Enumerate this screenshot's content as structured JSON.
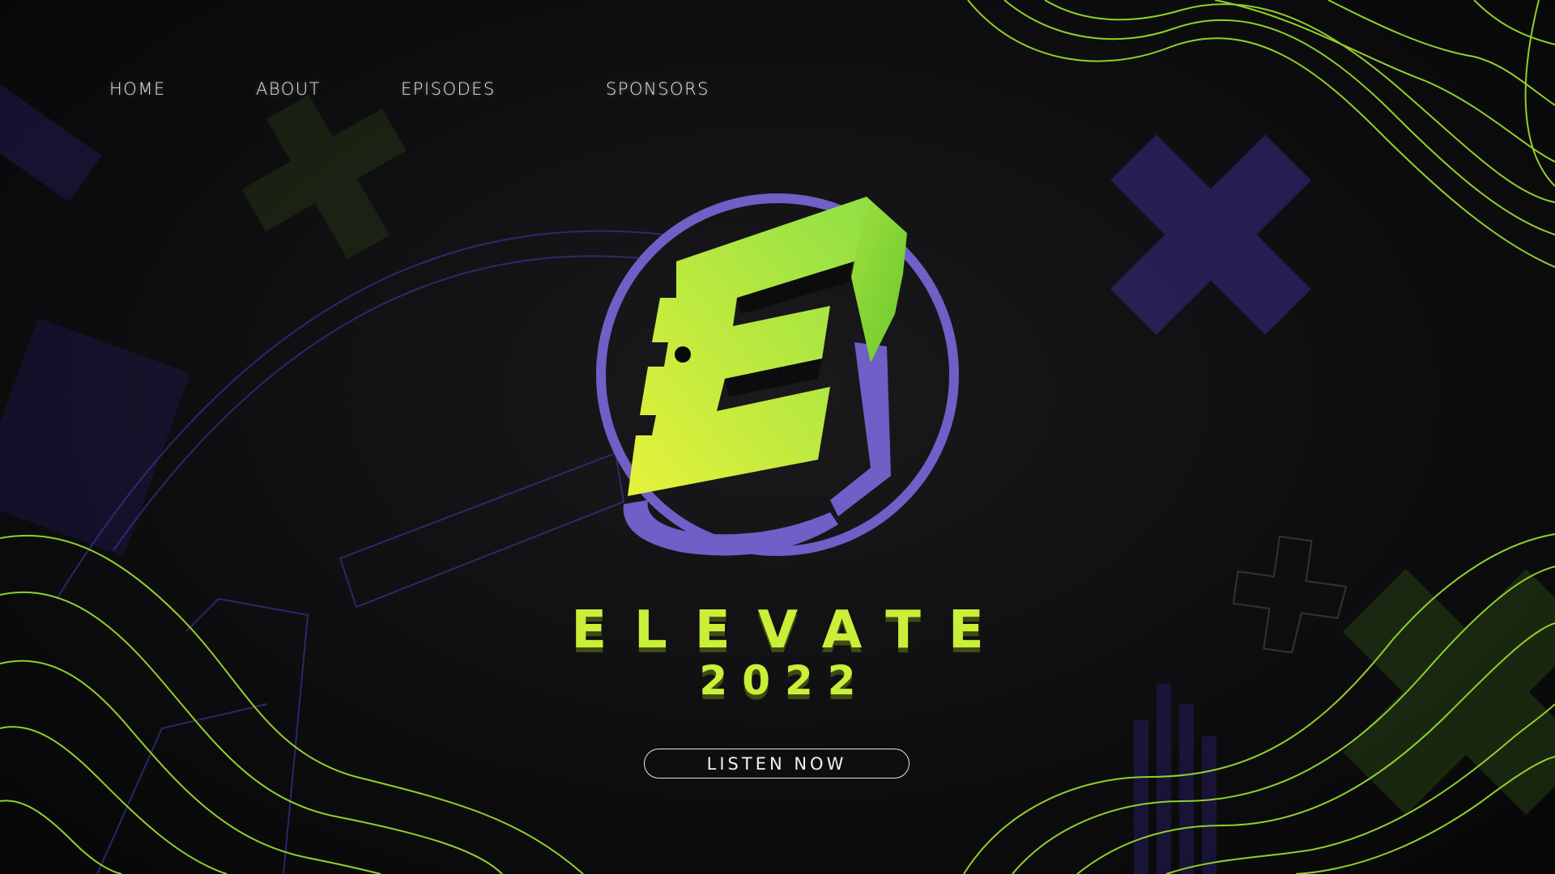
{
  "nav": {
    "items": [
      {
        "label": "HOME"
      },
      {
        "label": "ABOUT"
      },
      {
        "label": "EPISODES"
      },
      {
        "label": "SPONSORS"
      }
    ]
  },
  "hero": {
    "title": "ELEVATE",
    "year": "2022",
    "cta_label": "LISTEN NOW"
  },
  "colors": {
    "accent_green": "#c9ef39",
    "accent_purple": "#6f5fc7",
    "background": "#0e0e10"
  },
  "icons": {
    "logo": "elevate-e-logo-icon",
    "decor": [
      "x-shape-icon",
      "plus-shape-icon",
      "contour-lines"
    ]
  }
}
